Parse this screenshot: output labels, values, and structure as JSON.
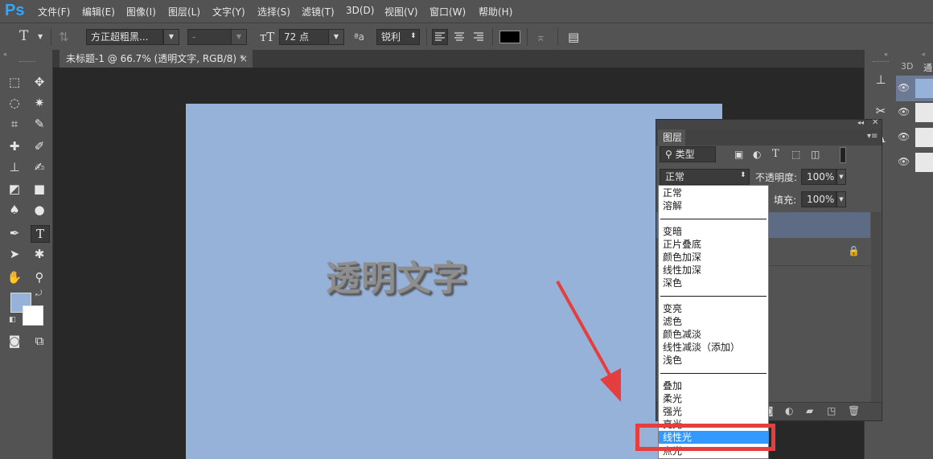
{
  "app": {
    "logo": "Ps"
  },
  "menu": [
    "文件(F)",
    "编辑(E)",
    "图像(I)",
    "图层(L)",
    "文字(Y)",
    "选择(S)",
    "滤镜(T)",
    "3D(D)",
    "视图(V)",
    "窗口(W)",
    "帮助(H)"
  ],
  "options": {
    "type_tool_glyph": "T",
    "font_family": "方正超粗黑...",
    "font_style": "-",
    "font_size": "72 点",
    "aa_label": "ªa",
    "antialias": "锐利",
    "text_color": "#000000"
  },
  "document": {
    "tab_title": "未标题-1 @ 66.7% (透明文字, RGB/8) *",
    "close": "×",
    "canvas_color": "#97b2d9"
  },
  "canvas": {
    "text": "透明文字"
  },
  "dock": {
    "tab_3d": "3D",
    "tab_other": "通"
  },
  "layers_panel": {
    "title": "图层",
    "filter_kind": "类型",
    "blend_mode": "正常",
    "opacity_label": "不透明度:",
    "opacity_value": "100%",
    "fill_label": "填充:",
    "fill_value": "100%"
  },
  "blend_modes": {
    "group1": [
      "正常",
      "溶解"
    ],
    "group2": [
      "变暗",
      "正片叠底",
      "颜色加深",
      "线性加深",
      "深色"
    ],
    "group3": [
      "变亮",
      "滤色",
      "颜色减淡",
      "线性减淡（添加）",
      "浅色"
    ],
    "group4": [
      "叠加",
      "柔光",
      "强光",
      "亮光",
      "线性光",
      "点光"
    ],
    "selected": "线性光"
  },
  "colors": {
    "accent": "#3399ff",
    "annotation": "#e43e3e"
  }
}
